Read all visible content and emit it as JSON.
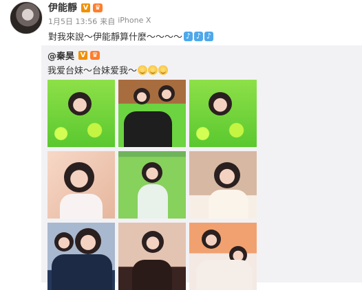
{
  "post": {
    "author": "伊能靜",
    "verified": "V",
    "member_badge": "♛",
    "date": "1月5日 13:56",
    "source_prefix": "来自",
    "source": "iPhone X",
    "text": "對我來說～伊能靜算什麼～～～～",
    "note_icons": [
      "♪",
      "♪",
      "♪"
    ]
  },
  "repost": {
    "author": "@秦昊",
    "verified": "V",
    "member_badge": "♛",
    "text": "我爱台妹～台妹爱我～",
    "emoji_count": 3
  },
  "photos": [
    {
      "label": "toddler-in-ball-pit-1"
    },
    {
      "label": "father-and-child-ball-pit"
    },
    {
      "label": "toddler-in-ball-pit-2"
    },
    {
      "label": "toddler-closeup-1"
    },
    {
      "label": "toddler-standing-ball-pit"
    },
    {
      "label": "toddler-closeup-2"
    },
    {
      "label": "father-kissing-child"
    },
    {
      "label": "toddler-at-table"
    },
    {
      "label": "father-and-child-table"
    }
  ]
}
